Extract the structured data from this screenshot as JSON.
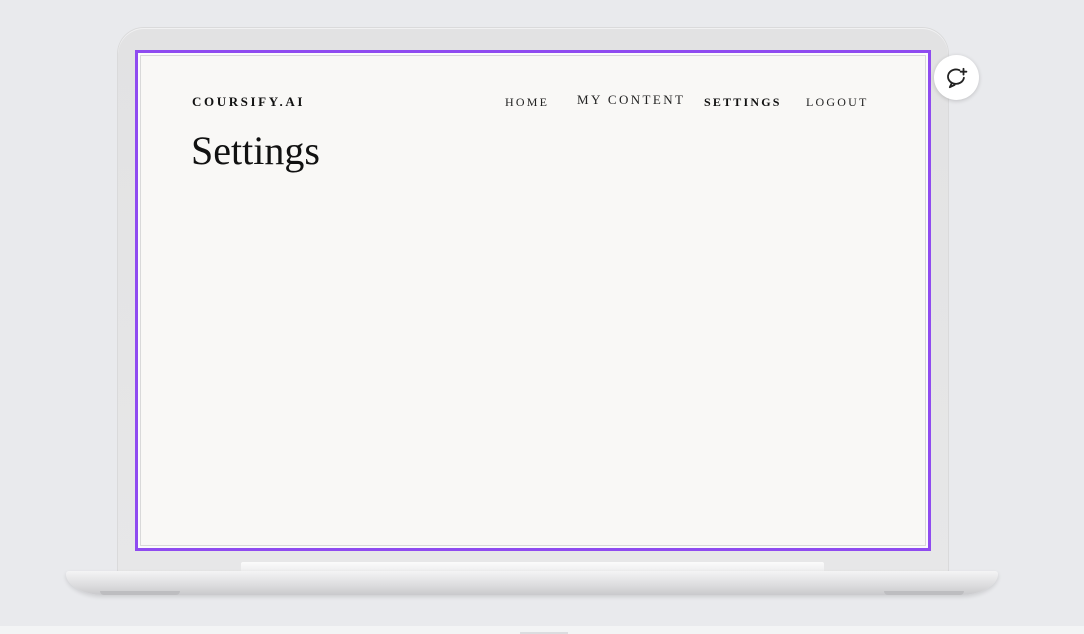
{
  "app": {
    "brand": "COURSIFY.AI"
  },
  "nav": {
    "items": [
      {
        "label": "HOME",
        "active": false
      },
      {
        "label": "MY CONTENT",
        "active": false
      },
      {
        "label": "SETTINGS",
        "active": true
      },
      {
        "label": "LOGOUT",
        "active": false
      }
    ]
  },
  "main": {
    "title": "Settings"
  },
  "fab": {
    "icon": "chat-plus-icon"
  },
  "colors": {
    "accent_border": "#8f4bf0",
    "page_background": "#f9f8f6",
    "outer_background": "#e9eaed"
  }
}
